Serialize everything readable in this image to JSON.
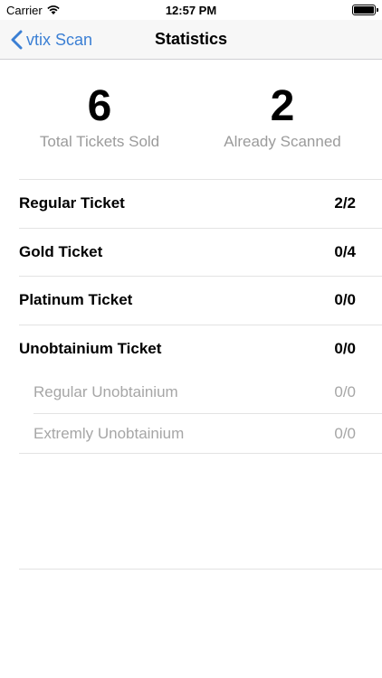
{
  "status_bar": {
    "carrier": "Carrier",
    "time": "12:57 PM"
  },
  "nav": {
    "back_label": "vtix Scan",
    "title": "Statistics"
  },
  "summary": {
    "total_sold": {
      "value": "6",
      "label": "Total Tickets Sold"
    },
    "scanned": {
      "value": "2",
      "label": "Already Scanned"
    }
  },
  "tickets": [
    {
      "name": "Regular Ticket",
      "count": "2/2"
    },
    {
      "name": "Gold Ticket",
      "count": "0/4"
    },
    {
      "name": "Platinum Ticket",
      "count": "0/0"
    },
    {
      "name": "Unobtainium Ticket",
      "count": "0/0",
      "subtypes": [
        {
          "name": "Regular Unobtainium",
          "count": "0/0"
        },
        {
          "name": "Extremly Unobtainium",
          "count": "0/0"
        }
      ]
    }
  ]
}
